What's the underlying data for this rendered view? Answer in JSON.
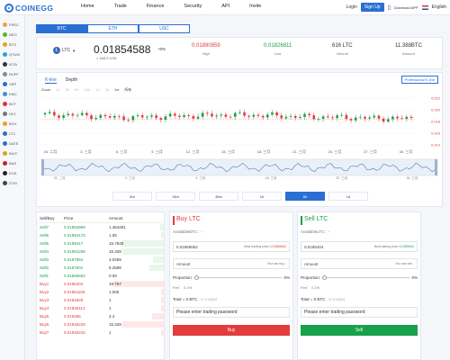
{
  "header": {
    "logo": "COINEGG",
    "nav": [
      "Home",
      "Trade",
      "Finance",
      "Security",
      "API",
      "Invite"
    ],
    "login": "Login",
    "signup": "Sign Up",
    "download": "Download APP",
    "language": "English"
  },
  "sidebar": {
    "items": [
      {
        "label": "FREC",
        "color": "#f2a23a"
      },
      {
        "label": "NEO",
        "color": "#59b52a"
      },
      {
        "label": "BTG",
        "color": "#e8a020"
      },
      {
        "label": "QTUM",
        "color": "#2aa3d9"
      },
      {
        "label": "IOTA",
        "color": "#333333"
      },
      {
        "label": "RUFF",
        "color": "#8a8a8a"
      },
      {
        "label": "XRP",
        "color": "#2a6fd3"
      },
      {
        "label": "KMC",
        "color": "#3a8ee6"
      },
      {
        "label": "BCT",
        "color": "#d33"
      },
      {
        "label": "HLC",
        "color": "#777"
      },
      {
        "label": "BCH",
        "color": "#f29c1f"
      },
      {
        "label": "LTC",
        "color": "#3b6bb5"
      },
      {
        "label": "DATE",
        "color": "#2a6fd3"
      },
      {
        "label": "INVC",
        "color": "#dca21f"
      },
      {
        "label": "BAS",
        "color": "#c62020"
      },
      {
        "label": "EOS",
        "color": "#222222"
      },
      {
        "label": "DTM",
        "color": "#444444"
      }
    ]
  },
  "market_tabs": [
    "BTC",
    "ETH",
    "USC"
  ],
  "ticker": {
    "coin": "LTC",
    "price": "0.01854588",
    "usd": "≈ 168.2 USD",
    "change": "+0%",
    "high": {
      "value": "0.01890859",
      "label": "High",
      "color": "#e23c3c"
    },
    "low": {
      "value": "0.01826811",
      "label": "Low",
      "color": "#18a14a"
    },
    "volume": {
      "value": "616 LTC",
      "label": "Volume"
    },
    "amount": {
      "value": "11.388BTC",
      "label": "Amount"
    }
  },
  "chart": {
    "tabs": [
      "K-line",
      "Depth"
    ],
    "professional": "Professional K-line",
    "zoom_label": "Zoom",
    "zoom": [
      "1h",
      "2h",
      "6h",
      "12h",
      "1d",
      "3d",
      "1w",
      "所有"
    ],
    "y_labels": [
      "0.022",
      "0.020",
      "0.018",
      "0.016",
      "0.014"
    ],
    "x_labels": [
      "24. 二月",
      "3. 三月",
      "6. 三月",
      "9. 三月",
      "12. 三月",
      "15. 三月",
      "18. 三月",
      "21. 三月",
      "24. 三月",
      "27. 三月",
      "30. 三月"
    ],
    "nav_labels": [
      "23. 二月",
      "2. 三月",
      "9. 三月",
      "16. 三月",
      "23. 三月",
      "30. 三月"
    ],
    "periods": [
      "5m",
      "15m",
      "30m",
      "1h",
      "8h",
      "1d"
    ],
    "active_period": "8h",
    "colors": {
      "up": "#18a14a",
      "down": "#e23c3c"
    }
  },
  "chart_data": {
    "type": "candlestick",
    "x": [
      "24. 二月",
      "3. 三月",
      "6. 三月",
      "9. 三月",
      "12. 三月",
      "15. 三月",
      "18. 三月",
      "21. 三月",
      "24. 三月",
      "27. 三月",
      "30. 三月"
    ],
    "close": [
      0.0195,
      0.0193,
      0.0188,
      0.019,
      0.0192,
      0.0194,
      0.0193,
      0.019,
      0.0189,
      0.0187,
      0.0186
    ],
    "ylim": [
      0.013,
      0.023
    ]
  },
  "orderbook": {
    "headers": [
      "Sell/Buy",
      "Price",
      "Amount"
    ],
    "sells": [
      [
        "Sell7",
        "0.01894999",
        "1.464291"
      ],
      [
        "Sell6",
        "0.01894173",
        "1.05"
      ],
      [
        "Sell5",
        "0.0189417",
        "15.7545"
      ],
      [
        "Sell4",
        "0.01891206",
        "15.329"
      ],
      [
        "Sell3",
        "0.0187862",
        "4.0269"
      ],
      [
        "Sell2",
        "0.0187601",
        "5.2688"
      ],
      [
        "Sell1",
        "0.01866652",
        "0.09"
      ]
    ],
    "buys": [
      [
        "Buy1",
        "0.0185404",
        "18.767"
      ],
      [
        "Buy2",
        "0.01851155",
        "1.005"
      ],
      [
        "Buy3",
        "0.0184929",
        "1"
      ],
      [
        "Buy4",
        "0.01846113",
        "1"
      ],
      [
        "Buy5",
        "0.018456",
        "4.4"
      ],
      [
        "Buy6",
        "0.01845228",
        "15.329"
      ],
      [
        "Buy7",
        "0.01845216",
        "1"
      ]
    ]
  },
  "buy_form": {
    "title": "Buy LTC",
    "available": "AvailableBTC：-",
    "price": "0.01866652",
    "best_label": "Best trading price",
    "best_value": "0.01866652",
    "amount_label": "Amount",
    "amount_hint": "You can buy",
    "amount_hint_value": "-",
    "proportion": "Proportion:",
    "proportion_pct": "0%",
    "fee": "Fee：  0.1%",
    "total": "Total = 0 BTC",
    "total_usd": "（≈ 0 USD）",
    "password": "Please enter trading password",
    "button": "Buy"
  },
  "sell_form": {
    "title": "Sell LTC",
    "available": "AvailableLTC：-",
    "price": "0.0185404",
    "best_label": "Best asking price",
    "best_value": "0.0185404",
    "amount_label": "Amount",
    "amount_hint": "You can sell",
    "amount_hint_value": "-",
    "proportion": "Proportion:",
    "proportion_pct": "0%",
    "fee": "Fee：  0.1%",
    "total": "Total = 0 BTC",
    "total_usd": "（≈ 0 USD）",
    "password": "Please enter trading password",
    "button": "Sell"
  }
}
